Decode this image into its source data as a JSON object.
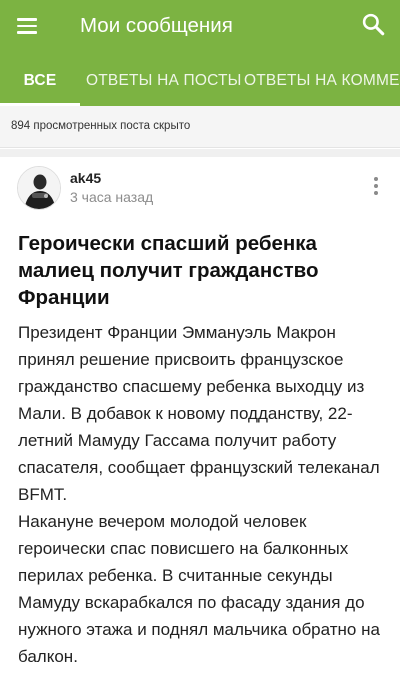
{
  "app_bar": {
    "title": "Мои сообщения",
    "menu_icon": "hamburger-menu-icon",
    "search_icon": "search-icon",
    "color": "#7cb342"
  },
  "tabs": [
    {
      "label": "Все",
      "selected": true
    },
    {
      "label": "Ответы на посты",
      "selected": false
    },
    {
      "label": "Ответы на комментарии",
      "selected": false
    }
  ],
  "hidden_notice": "894 просмотренных поста скрыто",
  "post": {
    "author": "ak45",
    "time": "3 часа назад",
    "more_icon": "more-vertical-icon",
    "title": "Героически спасший ребенка малиец получит гражданство Франции",
    "paragraphs": [
      "Президент Франции Эммануэль Макрон принял решение присвоить французское гражданство спасшему ребенка выходцу из Мали. В добавок к новому подданству, 22-летний Мамуду Гассама получит работу спасателя, сообщает французский телеканал BFMT.",
      "Накануне вечером молодой человек героически спас повисшего на балконных перилах ребенка. В считанные секунды Мамуду вскарабкался по фасаду здания до нужного этажа и поднял мальчика обратно на балкон."
    ]
  }
}
